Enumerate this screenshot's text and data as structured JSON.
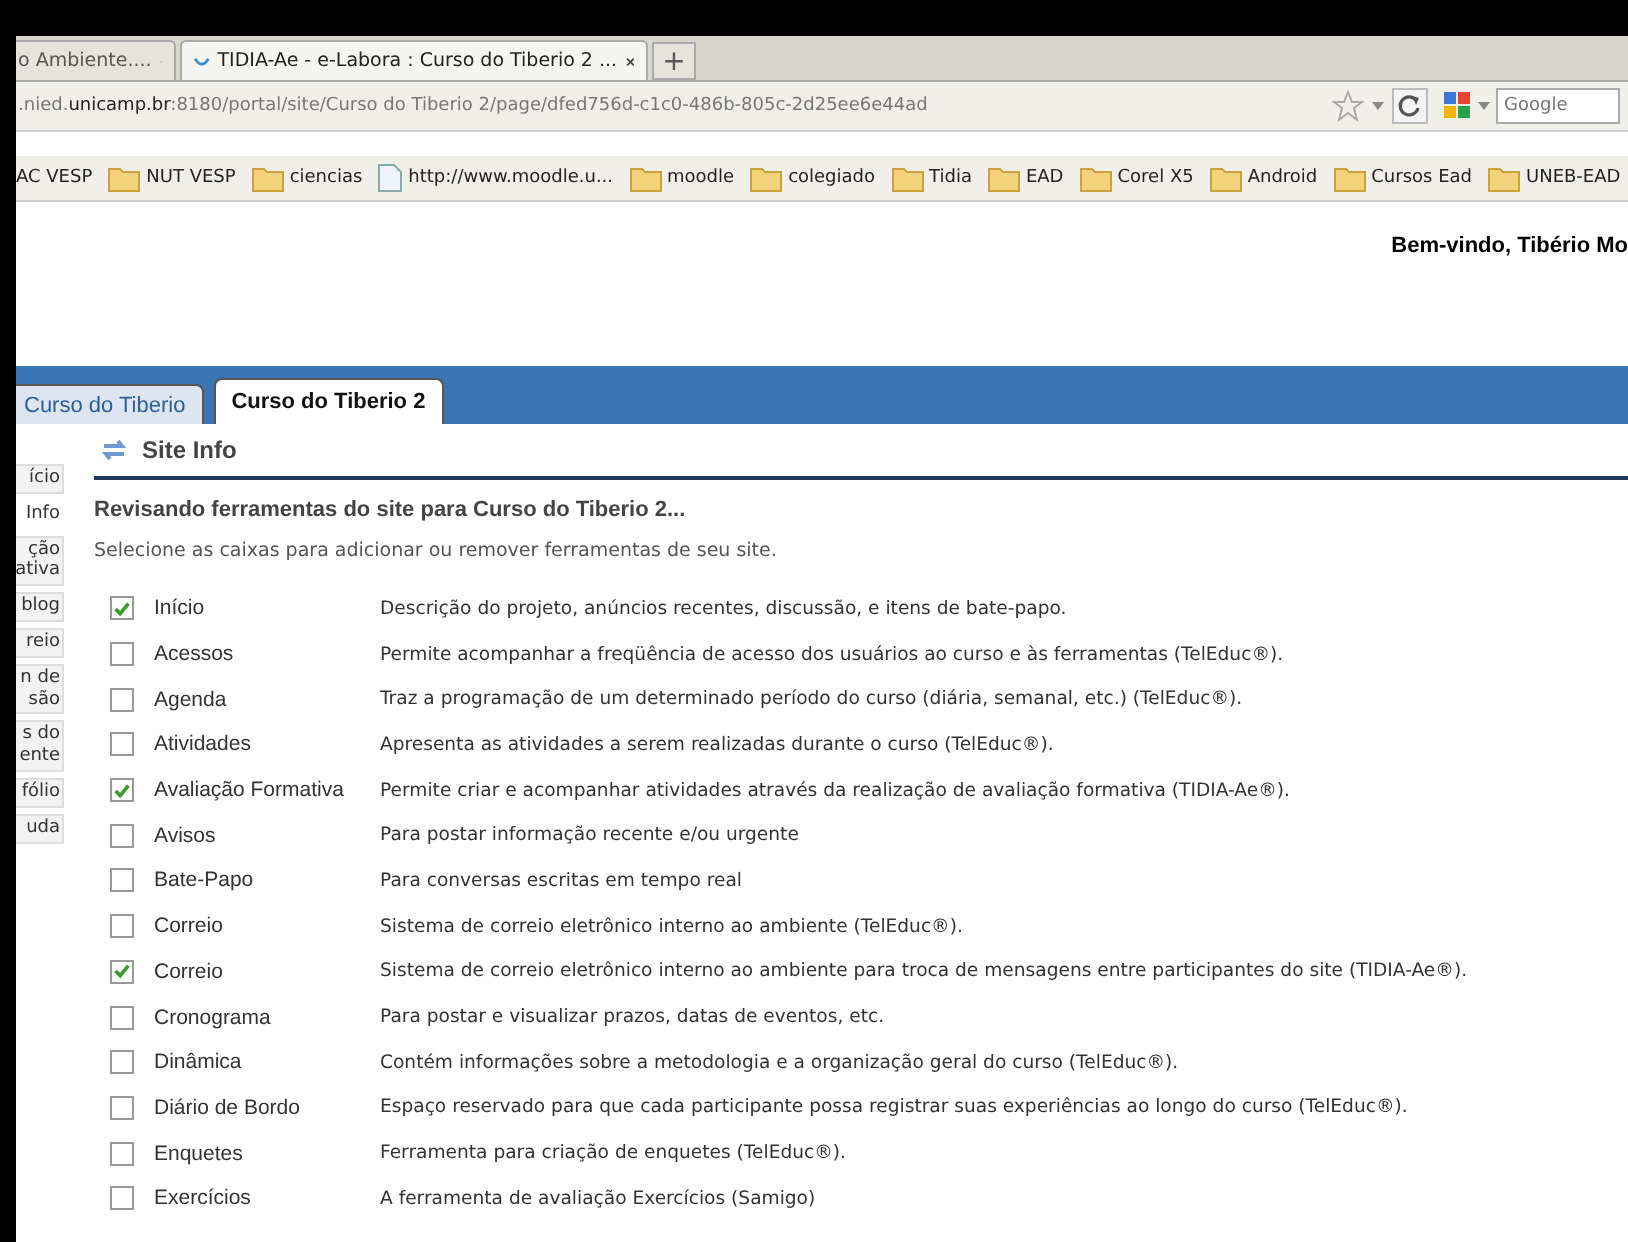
{
  "browser": {
    "tabs": [
      {
        "title": "o Ambiente....",
        "selected": false
      },
      {
        "title": "TIDIA-Ae - e-Labora : Curso do Tiberio 2 ...",
        "selected": true
      }
    ],
    "new_tab": "+",
    "url": {
      "prefix": ".nied.",
      "domain": "unicamp.br",
      "rest": ":8180/portal/site/Curso do Tiberio 2/page/dfed756d-c1c0-486b-805c-2d25ee6e44ad"
    },
    "search": {
      "placeholder": "Google"
    },
    "bookmarks": [
      {
        "label": "AC VESP",
        "kind": "plain"
      },
      {
        "label": "NUT VESP",
        "kind": "folder"
      },
      {
        "label": "ciencias",
        "kind": "folder"
      },
      {
        "label": "http://www.moodle.u...",
        "kind": "page"
      },
      {
        "label": "moodle",
        "kind": "folder"
      },
      {
        "label": "colegiado",
        "kind": "folder"
      },
      {
        "label": "Tidia",
        "kind": "folder"
      },
      {
        "label": "EAD",
        "kind": "folder"
      },
      {
        "label": "Corel X5",
        "kind": "folder"
      },
      {
        "label": "Android",
        "kind": "folder"
      },
      {
        "label": "Cursos Ead",
        "kind": "folder"
      },
      {
        "label": "UNEB-EAD",
        "kind": "folder"
      }
    ]
  },
  "welcome": "Bem-vindo, Tibério Mo",
  "site_tabs": [
    {
      "label": "Curso do Tiberio",
      "selected": false
    },
    {
      "label": "Curso do Tiberio 2",
      "selected": true
    }
  ],
  "sidebar": {
    "items": [
      {
        "lines": [
          "ício"
        ],
        "selected": false
      },
      {
        "lines": [
          "Info"
        ],
        "selected": true
      },
      {
        "lines": [
          "ção",
          "ativa"
        ],
        "selected": false
      },
      {
        "lines": [
          "blog"
        ],
        "selected": false
      },
      {
        "lines": [
          "reio"
        ],
        "selected": false
      },
      {
        "lines": [
          "n de",
          "são"
        ],
        "selected": false
      },
      {
        "lines": [
          "s do",
          "ente"
        ],
        "selected": false
      },
      {
        "lines": [
          "fólio"
        ],
        "selected": false
      },
      {
        "lines": [
          "uda"
        ],
        "selected": false
      }
    ]
  },
  "tool_title": "Site Info",
  "heading": "Revisando ferramentas do site para Curso do Tiberio 2...",
  "instructions": "Selecione as caixas para adicionar ou remover ferramentas de seu site.",
  "tools": [
    {
      "name": "Início",
      "checked": true,
      "description": "Descrição do projeto, anúncios recentes, discussão, e itens de bate-papo."
    },
    {
      "name": "Acessos",
      "checked": false,
      "description": "Permite acompanhar a freqüência de acesso dos usuários ao curso e às ferramentas (TelEduc®)."
    },
    {
      "name": "Agenda",
      "checked": false,
      "description": "Traz a programação de um determinado período do curso (diária, semanal, etc.) (TelEduc®)."
    },
    {
      "name": "Atividades",
      "checked": false,
      "description": "Apresenta as atividades a serem realizadas durante o curso (TelEduc®)."
    },
    {
      "name": "Avaliação Formativa",
      "checked": true,
      "description": "Permite criar e acompanhar atividades através da realização de avaliação formativa (TIDIA-Ae®)."
    },
    {
      "name": "Avisos",
      "checked": false,
      "description": "Para postar informação recente e/ou urgente"
    },
    {
      "name": "Bate-Papo",
      "checked": false,
      "description": "Para conversas escritas em tempo real"
    },
    {
      "name": "Correio",
      "checked": false,
      "description": "Sistema de correio eletrônico interno ao ambiente (TelEduc®)."
    },
    {
      "name": "Correio",
      "checked": true,
      "description": "Sistema de correio eletrônico interno ao ambiente para troca de mensagens entre participantes do site (TIDIA-Ae®)."
    },
    {
      "name": "Cronograma",
      "checked": false,
      "description": "Para postar e visualizar prazos, datas de eventos, etc."
    },
    {
      "name": "Dinâmica",
      "checked": false,
      "description": "Contém informações sobre a metodologia e a organização geral do curso (TelEduc®)."
    },
    {
      "name": "Diário de Bordo",
      "checked": false,
      "description": "Espaço reservado para que cada participante possa registrar suas experiências ao longo do curso (TelEduc®)."
    },
    {
      "name": "Enquetes",
      "checked": false,
      "description": "Ferramenta para criação de enquetes (TelEduc®)."
    },
    {
      "name": "Exercícios",
      "checked": false,
      "description": "A ferramenta de avaliação Exercícios (Samigo)"
    }
  ]
}
